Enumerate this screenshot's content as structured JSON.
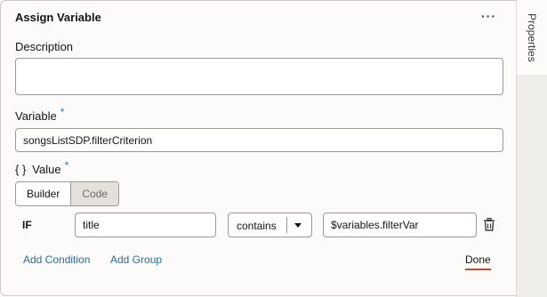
{
  "panel": {
    "title": "Assign Variable",
    "more_label": "···"
  },
  "side_tab": {
    "label": "Properties"
  },
  "description": {
    "label": "Description",
    "value": ""
  },
  "variable": {
    "label": "Variable",
    "required_mark": "*",
    "value": "songsListSDP.filterCriterion"
  },
  "value_section": {
    "icon_text": "{ }",
    "label": "Value",
    "required_mark": "*"
  },
  "mode_toggle": {
    "builder_label": "Builder",
    "code_label": "Code",
    "selected": "Builder"
  },
  "condition": {
    "keyword": "IF",
    "field_value": "title",
    "operator": "contains",
    "compare_value": "$variables.filterVar"
  },
  "actions": {
    "add_condition": "Add Condition",
    "add_group": "Add Group",
    "done": "Done"
  },
  "colors": {
    "link": "#2b6c9e",
    "required": "#227ac0",
    "done_underline": "#c74634"
  }
}
